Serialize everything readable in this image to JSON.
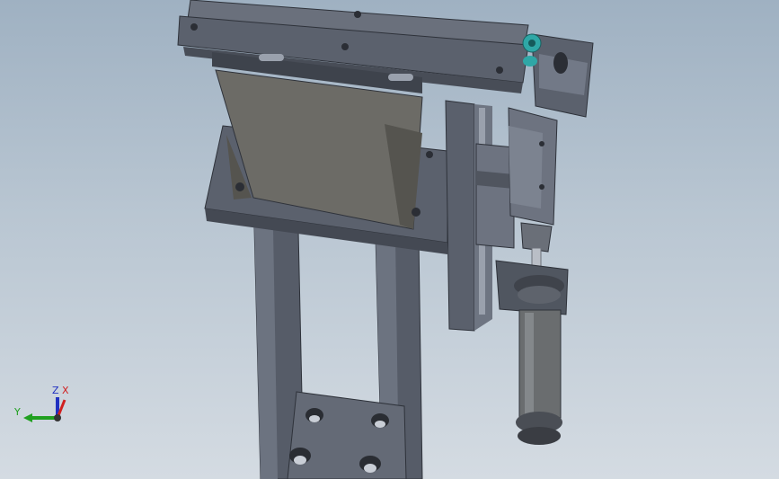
{
  "viewport": {
    "colors": {
      "background_top": "#9fb1c2",
      "background_bottom": "#d4dbe2",
      "metal_dark": "#4f5560",
      "metal_mid": "#656b77",
      "metal_light": "#8a909b",
      "bracket": "#6b6a63",
      "accent_teal": "#2fa7a6"
    }
  },
  "triad": {
    "x_label": "X",
    "y_label": "Y",
    "z_label": "Z",
    "colors": {
      "x": "#d02020",
      "y": "#20a020",
      "z": "#2030c0"
    }
  }
}
